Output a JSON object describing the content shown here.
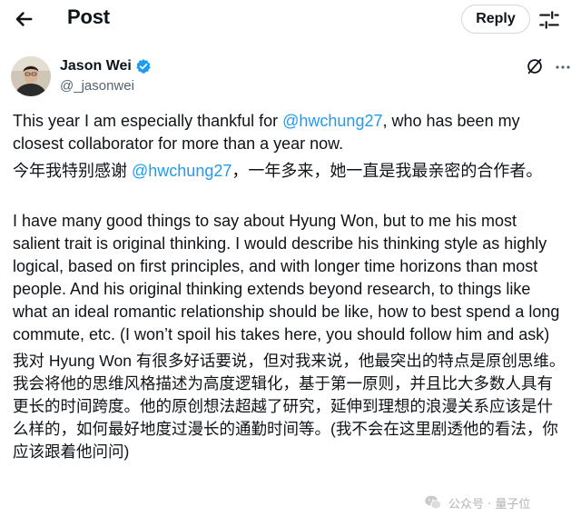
{
  "header": {
    "title": "Post",
    "reply_label": "Reply",
    "back_icon": "arrow-left-icon",
    "filter_icon": "sliders-icon"
  },
  "author": {
    "name": "Jason Wei",
    "handle": "@_jasonwei",
    "verified": true
  },
  "tweet": {
    "para1_before": "This year I am especially thankful for ",
    "para1_mention": "@hwchung27",
    "para1_after": ", who has been my closest collaborator for more than a year now.",
    "para1_cn_before": "今年我特别感谢 ",
    "para1_cn_mention": "@hwchung27",
    "para1_cn_after": "，一年多来，她一直是我最亲密的合作者。",
    "para2": "I have many good things to say about Hyung Won, but to me his most salient trait is original thinking. I would describe his thinking style as highly logical, based on first principles, and with longer time horizons than most people. And his original thinking extends beyond research, to things like what an ideal romantic relationship should be like, how to best spend a long commute, etc. (I won’t spoil his takes here, you should follow him and ask)",
    "para2_cn": "我对 Hyung Won 有很多好话要说，但对我来说，他最突出的特点是原创思维。我会将他的思维风格描述为高度逻辑化，基于第一原则，并且比大多数人具有更长的时间跨度。他的原创想法超越了研究，延伸到理想的浪漫关系应该是什么样的，如何最好地度过漫长的通勤时间等。(我不会在这里剧透他的看法，你应该跟着他问问)"
  },
  "watermark": {
    "text": "公众号 · 量子位"
  },
  "colors": {
    "accent": "#1d9bf0",
    "text": "#0f1419",
    "secondary": "#536471",
    "border": "#cfd9de"
  }
}
